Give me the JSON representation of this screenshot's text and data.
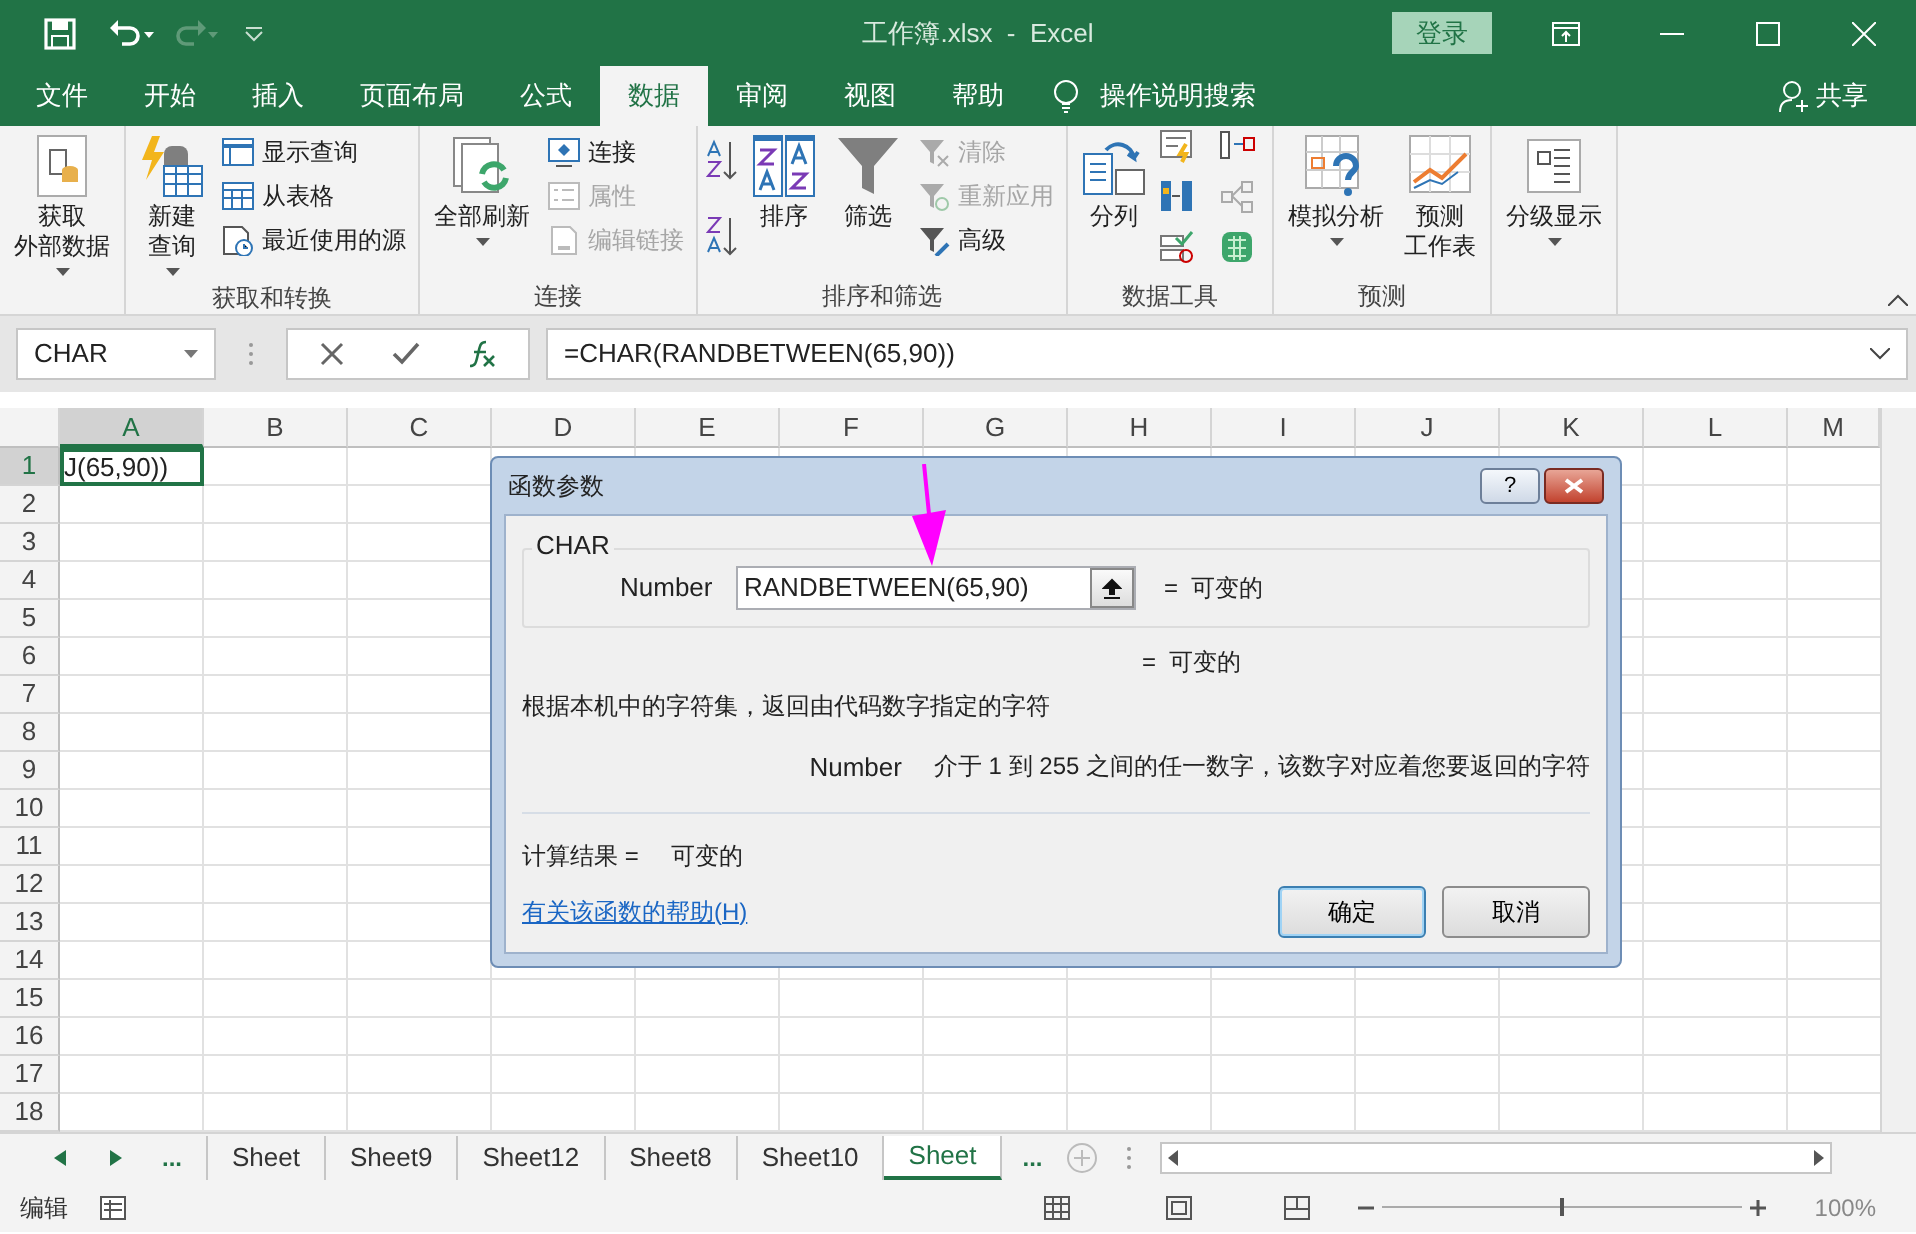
{
  "window": {
    "title": "工作簿.xlsx  -  Excel",
    "sign_in": "登录"
  },
  "ribbon_tabs": [
    {
      "label": "文件",
      "selected": false
    },
    {
      "label": "开始",
      "selected": false
    },
    {
      "label": "插入",
      "selected": false
    },
    {
      "label": "页面布局",
      "selected": false
    },
    {
      "label": "公式",
      "selected": false
    },
    {
      "label": "数据",
      "selected": true
    },
    {
      "label": "审阅",
      "selected": false
    },
    {
      "label": "视图",
      "selected": false
    },
    {
      "label": "帮助",
      "selected": false
    }
  ],
  "tell_me": "操作说明搜索",
  "share": "共享",
  "ribbon_groups": [
    {
      "items": [
        {
          "kind": "large",
          "lines": [
            "获取",
            "外部数据"
          ],
          "dropdown": true
        }
      ]
    },
    {
      "label": "获取和转换",
      "items": [
        {
          "kind": "large",
          "lines": [
            "新建",
            "查询"
          ],
          "dropdown": true
        },
        {
          "kind": "stack",
          "items": [
            {
              "label": "显示查询",
              "disabled": false
            },
            {
              "label": "从表格",
              "disabled": false
            },
            {
              "label": "最近使用的源",
              "disabled": false
            }
          ]
        }
      ]
    },
    {
      "label": "连接",
      "items": [
        {
          "kind": "large",
          "lines": [
            "全部刷新"
          ],
          "dropdown": true
        },
        {
          "kind": "stack",
          "items": [
            {
              "label": "连接",
              "disabled": false
            },
            {
              "label": "属性",
              "disabled": true
            },
            {
              "label": "编辑链接",
              "disabled": true
            }
          ]
        }
      ]
    },
    {
      "label": "排序和筛选",
      "items": [
        {
          "kind": "sort_icons"
        },
        {
          "kind": "large",
          "lines": [
            "排序"
          ],
          "dropdown": false
        },
        {
          "kind": "large",
          "lines": [
            "筛选"
          ],
          "dropdown": false
        },
        {
          "kind": "stack",
          "items": [
            {
              "label": "清除",
              "disabled": true
            },
            {
              "label": "重新应用",
              "disabled": true
            },
            {
              "label": "高级",
              "disabled": false
            }
          ]
        }
      ]
    },
    {
      "label": "数据工具",
      "items": [
        {
          "kind": "large",
          "lines": [
            "分列"
          ],
          "dropdown": false
        },
        {
          "kind": "icon_grid"
        }
      ]
    },
    {
      "label": "预测",
      "items": [
        {
          "kind": "large",
          "lines": [
            "模拟分析"
          ],
          "dropdown": true
        },
        {
          "kind": "large",
          "lines": [
            "预测",
            "工作表"
          ],
          "dropdown": false
        }
      ]
    },
    {
      "items": [
        {
          "kind": "large",
          "lines": [
            "分级显示"
          ],
          "dropdown": true
        }
      ]
    }
  ],
  "formula_bar": {
    "name_box": "CHAR",
    "formula": "=CHAR(RANDBETWEEN(65,90))"
  },
  "columns": [
    "A",
    "B",
    "C",
    "D",
    "E",
    "F",
    "G",
    "H",
    "I",
    "J",
    "K",
    "L",
    "M"
  ],
  "rows": [
    "1",
    "2",
    "3",
    "4",
    "5",
    "6",
    "7",
    "8",
    "9",
    "10",
    "11",
    "12",
    "13",
    "14",
    "15",
    "16",
    "17",
    "18"
  ],
  "active_cell": {
    "value": "J(65,90))"
  },
  "dialog": {
    "title": "函数参数",
    "help": "?",
    "function_name": "CHAR",
    "argument_label": "Number",
    "argument_value": "RANDBETWEEN(65,90)",
    "argument_result": "=  可变的",
    "function_result": "=  可变的",
    "description": "根据本机中的字符集，返回由代码数字指定的字符",
    "argument_name": "Number",
    "argument_description": "介于 1 到 255 之间的任一数字，该数字对应着您要返回的字符",
    "result_label": "计算结果 =",
    "result_value": "可变的",
    "help_link": "有关该函数的帮助(H)",
    "buttons": [
      {
        "label": "确定",
        "default": true
      },
      {
        "label": "取消",
        "default": false
      }
    ]
  },
  "sheet_nav": {
    "more": "..."
  },
  "sheet_tabs": [
    {
      "label": "Sheet",
      "selected": false
    },
    {
      "label": "Sheet9",
      "selected": false
    },
    {
      "label": "Sheet12",
      "selected": false
    },
    {
      "label": "Sheet8",
      "selected": false
    },
    {
      "label": "Sheet10",
      "selected": false
    },
    {
      "label": "Sheet",
      "selected": true
    }
  ],
  "sheet_more": "...",
  "status_bar": {
    "mode": "编辑",
    "zoom": "100%",
    "zoom_slider": {
      "level": 0.5
    }
  }
}
